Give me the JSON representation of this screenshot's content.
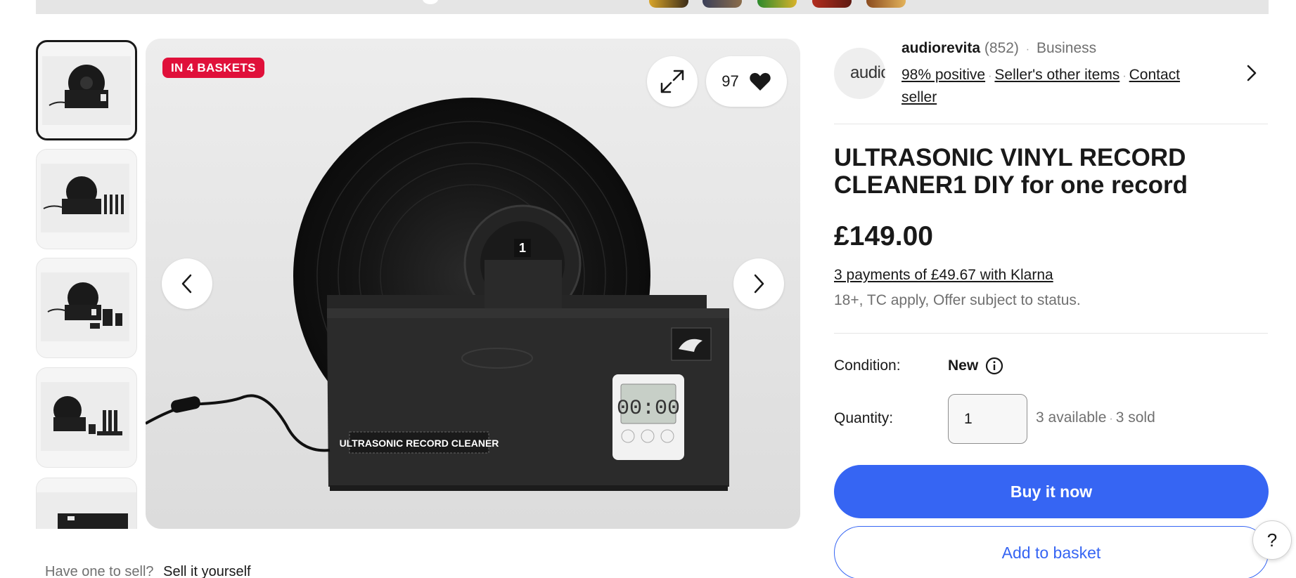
{
  "gallery": {
    "badge": "IN 4 BASKETS",
    "watch_count": "97",
    "photo_label": "ULTRASONIC RECORD CLEANER",
    "timer_display": "00:00",
    "record_number": "1",
    "icons": {
      "expand": "expand-icon",
      "heart": "heart-icon",
      "prev": "chevron-left-icon",
      "next": "chevron-right-icon"
    }
  },
  "sell": {
    "prompt": "Have one to sell?",
    "link": "Sell it yourself"
  },
  "seller": {
    "avatar_text": "audiorevita",
    "name": "audiorevita",
    "feedback_count": "(852)",
    "type": "Business",
    "positive": "98% positive",
    "other_items": "Seller's other items",
    "contact": "Contact seller"
  },
  "listing": {
    "title": "ULTRASONIC VINYL RECORD CLEANER1 DIY for one record",
    "price": "£149.00",
    "klarna": "3 payments of £49.67 with Klarna",
    "klarna_note": "18+, TC apply, Offer subject to status."
  },
  "condition": {
    "label": "Condition:",
    "value": "New"
  },
  "quantity": {
    "label": "Quantity:",
    "value": "1",
    "available": "3 available",
    "sold": "3 sold"
  },
  "actions": {
    "buy_now": "Buy it now",
    "add_to_basket": "Add to basket",
    "help": "?"
  },
  "colors": {
    "accent": "#3665f3",
    "badge": "#e0103a",
    "text": "#191919",
    "muted": "#707070"
  }
}
